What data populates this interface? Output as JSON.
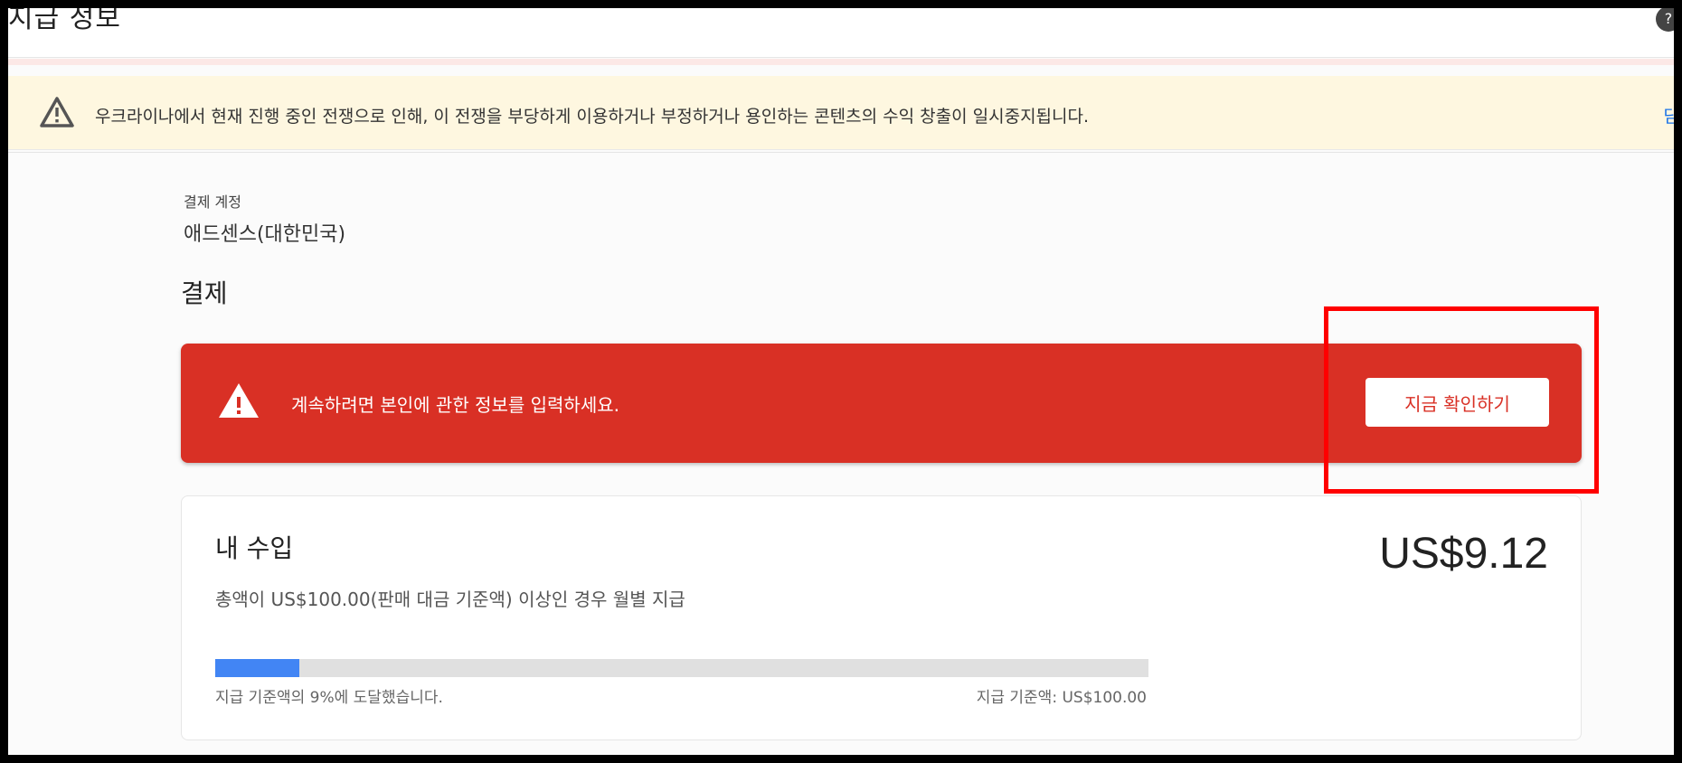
{
  "header": {
    "title": "지급 정보",
    "help_icon": "help-icon"
  },
  "notice": {
    "icon": "warning-icon",
    "text": "우크라이나에서 현재 진행 중인 전쟁으로 인해, 이 전쟁을 부당하게 이용하거나 부정하거나 용인하는 콘텐츠의 수익 창출이 일시중지됩니다.",
    "link_text": "닫"
  },
  "account": {
    "label": "결제 계정",
    "value": "애드센스(대한민국)"
  },
  "payment": {
    "title": "결제",
    "alert": {
      "icon": "warning-icon",
      "text": "계속하려면 본인에 관한 정보를 입력하세요.",
      "button_label": "지금 확인하기",
      "color": "#d93025"
    }
  },
  "earnings": {
    "title": "내 수입",
    "description": "총액이 US$100.00(판매 대금 기준액) 이상인 경우 월별 지급",
    "amount": "US$9.12",
    "progress_percent": 9,
    "progress_text": "지급 기준액의 9%에 도달했습니다.",
    "threshold_text": "지급 기준액: US$100.00",
    "progress_color": "#4285f4"
  },
  "highlight": {
    "color": "#ff0000"
  }
}
